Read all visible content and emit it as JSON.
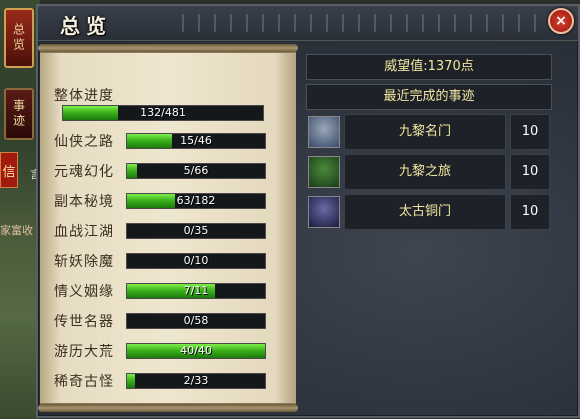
{
  "side_tabs": [
    "总览",
    "事迹"
  ],
  "side_chip": "信",
  "side_quote": "言",
  "side_text": "家富收",
  "window": {
    "title": "总览",
    "close_symbol": "×"
  },
  "overall": {
    "label": "整体进度",
    "current": 132,
    "total": 481,
    "text": "132/481"
  },
  "categories": [
    {
      "name": "仙侠之路",
      "current": 15,
      "total": 46,
      "text": "15/46"
    },
    {
      "name": "元魂幻化",
      "current": 5,
      "total": 66,
      "text": "5/66"
    },
    {
      "name": "副本秘境",
      "current": 63,
      "total": 182,
      "text": "63/182"
    },
    {
      "name": "血战江湖",
      "current": 0,
      "total": 35,
      "text": "0/35"
    },
    {
      "name": "斩妖除魔",
      "current": 0,
      "total": 10,
      "text": "0/10"
    },
    {
      "name": "情义姻缘",
      "current": 7,
      "total": 11,
      "text": "7/11"
    },
    {
      "name": "传世名器",
      "current": 0,
      "total": 58,
      "text": "0/58"
    },
    {
      "name": "游历大荒",
      "current": 40,
      "total": 40,
      "text": "40/40"
    },
    {
      "name": "稀奇古怪",
      "current": 2,
      "total": 33,
      "text": "2/33"
    }
  ],
  "prestige": "威望值:1370点",
  "recent_title": "最近完成的事迹",
  "recent": [
    {
      "name": "九黎名门",
      "points": "10",
      "icon": "gate-icon",
      "icon_colors": [
        "#9aa8b8",
        "#3a4a6a"
      ]
    },
    {
      "name": "九黎之旅",
      "points": "10",
      "icon": "forest-icon",
      "icon_colors": [
        "#4a8a3a",
        "#1a3a1a"
      ]
    },
    {
      "name": "太古铜门",
      "points": "10",
      "icon": "portal-icon",
      "icon_colors": [
        "#6a6aa8",
        "#1a1a3a"
      ]
    }
  ]
}
